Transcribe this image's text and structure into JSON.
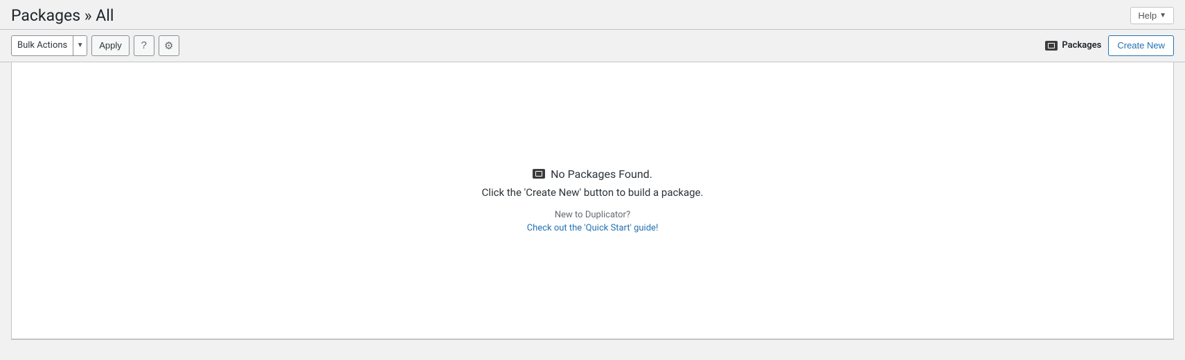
{
  "header": {
    "title": "Packages » All",
    "help_label": "Help"
  },
  "toolbar": {
    "bulk_actions_label": "Bulk Actions",
    "apply_label": "Apply",
    "packages_label": "Packages",
    "create_new_label": "Create New"
  },
  "empty_state": {
    "icon_label": "📦",
    "title": "No Packages Found.",
    "subtitle": "Click the 'Create New' button to build a package.",
    "new_to_label": "New to Duplicator?",
    "quick_start_label": "Check out the 'Quick Start' guide!"
  }
}
